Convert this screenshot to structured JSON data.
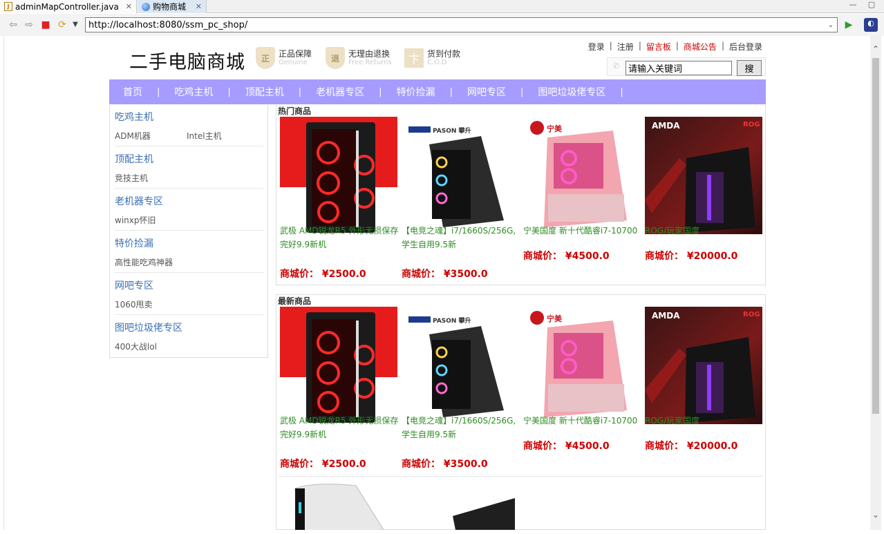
{
  "editor_tabs": [
    {
      "label": "adminMapController.java",
      "active": false
    },
    {
      "label": "购物商城",
      "active": true
    }
  ],
  "browser": {
    "url": "http://localhost:8080/ssm_pc_shop/"
  },
  "header": {
    "logo": "二手电脑商城",
    "badges": [
      {
        "title": "正品保障",
        "sub": "Genuine",
        "icon": "正"
      },
      {
        "title": "无理由退换",
        "sub": "Free Returns",
        "icon": "退"
      },
      {
        "title": "货到付款",
        "sub": "C.O.D",
        "icon": "卞"
      }
    ],
    "links": [
      "登录",
      "注册",
      "留言板",
      "商城公告",
      "后台登录"
    ],
    "search": {
      "value": "请输入关键词",
      "button": "搜"
    }
  },
  "nav": [
    "首页",
    "吃鸡主机",
    "顶配主机",
    "老机器专区",
    "特价捡漏",
    "网吧专区",
    "图吧垃圾佬专区"
  ],
  "nav_separator": "|",
  "categories": [
    {
      "title": "吃鸡主机",
      "subs": [
        "ADM机器",
        "Intel主机"
      ]
    },
    {
      "title": "顶配主机",
      "subs": [
        "竞技主机"
      ]
    },
    {
      "title": "老机器专区",
      "subs": [
        "winxp怀旧"
      ]
    },
    {
      "title": "特价捡漏",
      "subs": [
        "高性能吃鸡神器"
      ]
    },
    {
      "title": "网吧专区",
      "subs": [
        "1060甩卖"
      ]
    },
    {
      "title": "图吧垃圾佬专区",
      "subs": [
        "400大战lol"
      ]
    }
  ],
  "hot": {
    "title": "热门商品",
    "products": [
      {
        "name": "武极 AMD锐龙R5 外形无损保存完好9.9新机",
        "price": "商城价： ¥2500.0"
      },
      {
        "name": "【电竞之魂】i7/1660S/256G,学生自用9.5新",
        "price": "商城价： ¥3500.0"
      },
      {
        "name": "宁美国度 新十代酷睿i7-10700",
        "price": "商城价： ¥4500.0"
      },
      {
        "name": "ROG/玩家国度",
        "price": "商城价： ¥20000.0"
      }
    ]
  },
  "new": {
    "title": "最新商品",
    "products": [
      {
        "name": "武极 AMD锐龙R5 外形无损保存完好9.9新机",
        "price": "商城价： ¥2500.0"
      },
      {
        "name": "【电竞之魂】i7/1660S/256G,学生自用9.5新",
        "price": "商城价： ¥3500.0"
      },
      {
        "name": "宁美国度 新十代酷睿i7-10700",
        "price": "商城价： ¥4500.0"
      },
      {
        "name": "ROG/玩家国度",
        "price": "商城价： ¥20000.0"
      }
    ]
  },
  "image_marks": {
    "pason": "PASON 攀升",
    "ningmei": "宁美",
    "amd": "AMDA",
    "rog": "ROG"
  },
  "colors": {
    "nav_bg": "#a69cff",
    "price": "#cc0000",
    "product_name": "#2e8b22",
    "category_title": "#3a6fb3",
    "link_red": "#cc0000"
  }
}
